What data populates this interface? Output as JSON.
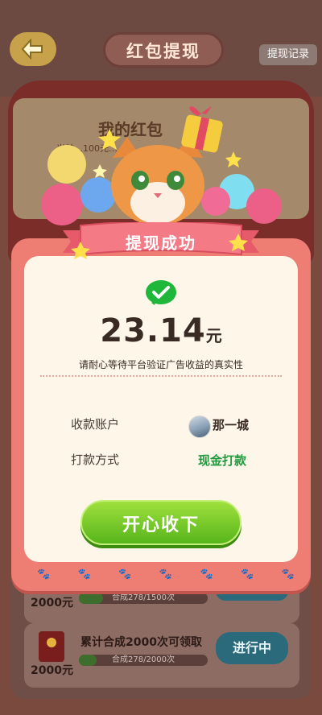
{
  "header": {
    "title": "红包提现",
    "record_label": "提现记录"
  },
  "background": {
    "my_red_packet": "我的红包",
    "bag_info": "当前…100元…"
  },
  "tasks": [
    {
      "amount": "2000元",
      "progress_text": "合成278/1500次",
      "progress": 0.185
    },
    {
      "amount": "2000元",
      "description": "累计合成2000次可领取",
      "progress_text": "合成278/2000次",
      "progress": 0.139,
      "button_label": "进行中"
    }
  ],
  "dialog": {
    "banner_title": "提现成功",
    "amount_value": "23.14",
    "amount_unit": "元",
    "notice": "请耐心等待平台验证广告收益的真实性",
    "account_label": "收款账户",
    "account_name": "那一城",
    "method_label": "打款方式",
    "method_value": "现金打款",
    "confirm_button": "开心收下"
  },
  "colors": {
    "dialog_border": "#ee7d73",
    "dialog_body": "#fdf6e9",
    "button_green": "#6cc523",
    "method_green": "#1c9a3c",
    "wechat_green": "#1fb73a"
  },
  "icons": [
    "back-arrow-icon",
    "wechat-icon",
    "paw-icon",
    "red-envelope-icon",
    "cat-illustration",
    "gift-icon",
    "balloon-icon",
    "star-icon"
  ]
}
